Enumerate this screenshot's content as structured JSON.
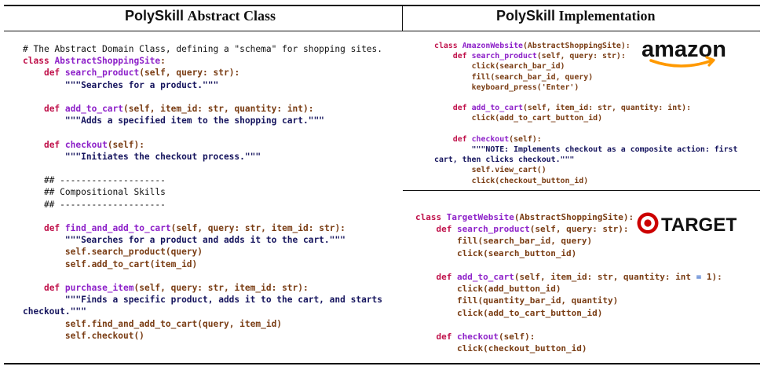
{
  "titles": {
    "left_bold": "PolySkill",
    "left_rest": "Abstract Class",
    "right_bold": "PolySkill",
    "right_rest": "Implementation"
  },
  "left_code": [
    "# The Abstract Domain Class, defining a \"schema\" for shopping sites.",
    "class AbstractShoppingSite:",
    "    def search_product(self, query: str):",
    "        \"\"\"Searches for a product.\"\"\"",
    "",
    "    def add_to_cart(self, item_id: str, quantity: int):",
    "        \"\"\"Adds a specified item to the shopping cart.\"\"\"",
    "",
    "    def checkout(self):",
    "        \"\"\"Initiates the checkout process.\"\"\"",
    "",
    "    ## --------------------",
    "    ## Compositional Skills",
    "    ## --------------------",
    "",
    "    def find_and_add_to_cart(self, query: str, item_id: str):",
    "        \"\"\"Searches for a product and adds it to the cart.\"\"\"",
    "        self.search_product(query)",
    "        self.add_to_cart(item_id)",
    "",
    "    def purchase_item(self, query: str, item_id: str):",
    "        \"\"\"Finds a specific product, adds it to the cart, and starts",
    "checkout.\"\"\"",
    "        self.find_and_add_to_cart(query, item_id)",
    "        self.checkout()"
  ],
  "amazon_code": [
    "class AmazonWebsite(AbstractShoppingSite):",
    "    def search_product(self, query: str):",
    "        click(search_bar_id)",
    "        fill(search_bar_id, query)",
    "        keyboard_press('Enter')",
    "",
    "    def add_to_cart(self, item_id: str, quantity: int):",
    "        click(add_to_cart_button_id)",
    "",
    "    def checkout(self):",
    "        \"\"\"NOTE: Implements checkout as a composite action: first",
    "cart, then clicks checkout.\"\"\"",
    "        self.view_cart()",
    "        click(checkout_button_id)"
  ],
  "target_code": [
    "class TargetWebsite(AbstractShoppingSite):",
    "    def search_product(self, query: str):",
    "        fill(search_bar_id, query)",
    "        click(search_button_id)",
    "",
    "    def add_to_cart(self, item_id: str, quantity: int = 1):",
    "        click(add_button_id)",
    "        fill(quantity_bar_id, quantity)",
    "        click(add_to_cart_button_id)",
    "",
    "    def checkout(self):",
    "        click(checkout_button_id)"
  ],
  "logos": {
    "amazon": "amazon",
    "target": "TARGET"
  },
  "colors": {
    "keyword": "#c0124b",
    "class_function": "#8e22c9",
    "docstring": "#16155e",
    "call": "#7a3d14",
    "amazon_arrow": "#ff9900",
    "target_red": "#cc0000"
  }
}
